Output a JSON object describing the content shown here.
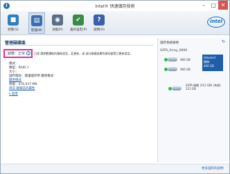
{
  "window": {
    "title": "Intel® 快速儲存技術",
    "min_glyph": "–",
    "max_glyph": "□",
    "close_glyph": "✕"
  },
  "toolbar": {
    "items": [
      {
        "label": "狀態(S)",
        "icon": "status-icon",
        "color": "#2e7fc1"
      },
      {
        "label": "管理(M)",
        "icon": "manage-icon",
        "color": "#3d6fb0"
      },
      {
        "label": "效能(P)",
        "icon": "performance-icon",
        "color": "#5a6f85"
      },
      {
        "label": "喜好設定(P)",
        "icon": "preferences-icon",
        "color": "#3b8a4a"
      },
      {
        "label": "說明(H)",
        "icon": "help-icon",
        "color": "#3b5fa8"
      }
    ],
    "logo": "intel"
  },
  "main": {
    "title": "管理磁碟區",
    "status_label": "狀態：",
    "status_value": "正常",
    "status_help": "?",
    "status_desc": "已設 請參數讀取的最新設定，此更新，或 部分磁碟區屬性資料都是已更新設定。",
    "lines": [
      {
        "text": "模式：",
        "link": false
      },
      {
        "text": "類型：RAID 1",
        "link": false
      },
      {
        "text": "大小：",
        "link": false
      },
      {
        "text": "儲存階段：建議儲存所 變更模式",
        "link": false
      },
      {
        "text": "變更模式",
        "link": true
      },
      {
        "text": "快取：476,937 MB",
        "link": false
      },
      {
        "text": "目前 磁碟區的屬性",
        "link": true
      },
      {
        "text": "▾ 進階",
        "link": true
      }
    ]
  },
  "side": {
    "title": "儲存系統檢視",
    "help_glyph": "↻",
    "array_label": "SATA_Array_0000",
    "disks": [
      {
        "label": "466 GB"
      },
      {
        "label": "466 GB"
      }
    ],
    "volume_card": {
      "line1": "Volume1",
      "line2": "鏡像：",
      "line3": "466 GB"
    },
    "bottom_disk": {
      "line1": "SATA 磁碟 (112 GB) (系統)",
      "line2": "112 GB"
    }
  },
  "footer": {
    "link": "更多儲存的說明"
  }
}
